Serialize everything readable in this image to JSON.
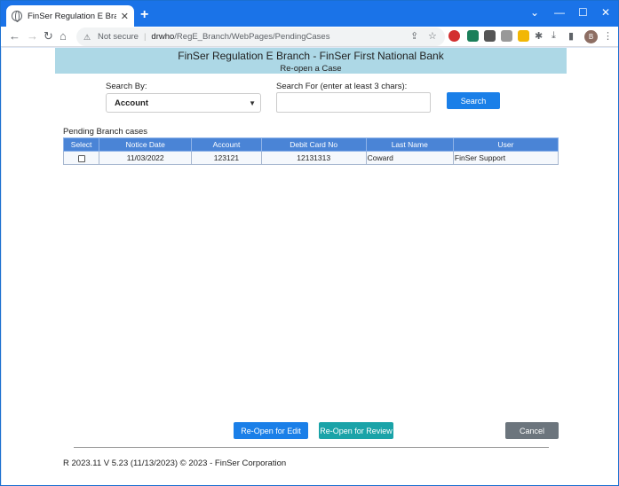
{
  "browser": {
    "tab_title": "FinSer Regulation E Branch Mod",
    "url_security": "Not secure",
    "url_host": "drwho",
    "url_path": "/RegE_Branch/WebPages/PendingCases",
    "avatar_letter": "B"
  },
  "banner": {
    "title": "FinSer Regulation E Branch - FinSer First National Bank",
    "subtitle": "Re-open a Case"
  },
  "search": {
    "by_label": "Search By:",
    "by_value": "Account",
    "for_label": "Search For (enter at least 3 chars):",
    "button": "Search"
  },
  "cases": {
    "title": "Pending Branch cases",
    "headers": [
      "Select",
      "Notice Date",
      "Account",
      "Debit Card No",
      "Last Name",
      "User"
    ],
    "rows": [
      {
        "notice_date": "11/03/2022",
        "account": "123121",
        "debit_card": "12131313",
        "last_name": "Coward",
        "user": "FinSer Support"
      }
    ]
  },
  "actions": {
    "reopen_edit": "Re-Open for Edit",
    "reopen_review": "Re-Open for Review",
    "cancel": "Cancel"
  },
  "footer": "R 2023.11 V 5.23 (11/13/2023) © 2023 - FinSer Corporation",
  "colors": {
    "banner": "#add8e6",
    "header_row": "#4a84d6",
    "primary": "#1a7fe8",
    "teal": "#1aa3a8",
    "gray": "#6c757d"
  }
}
